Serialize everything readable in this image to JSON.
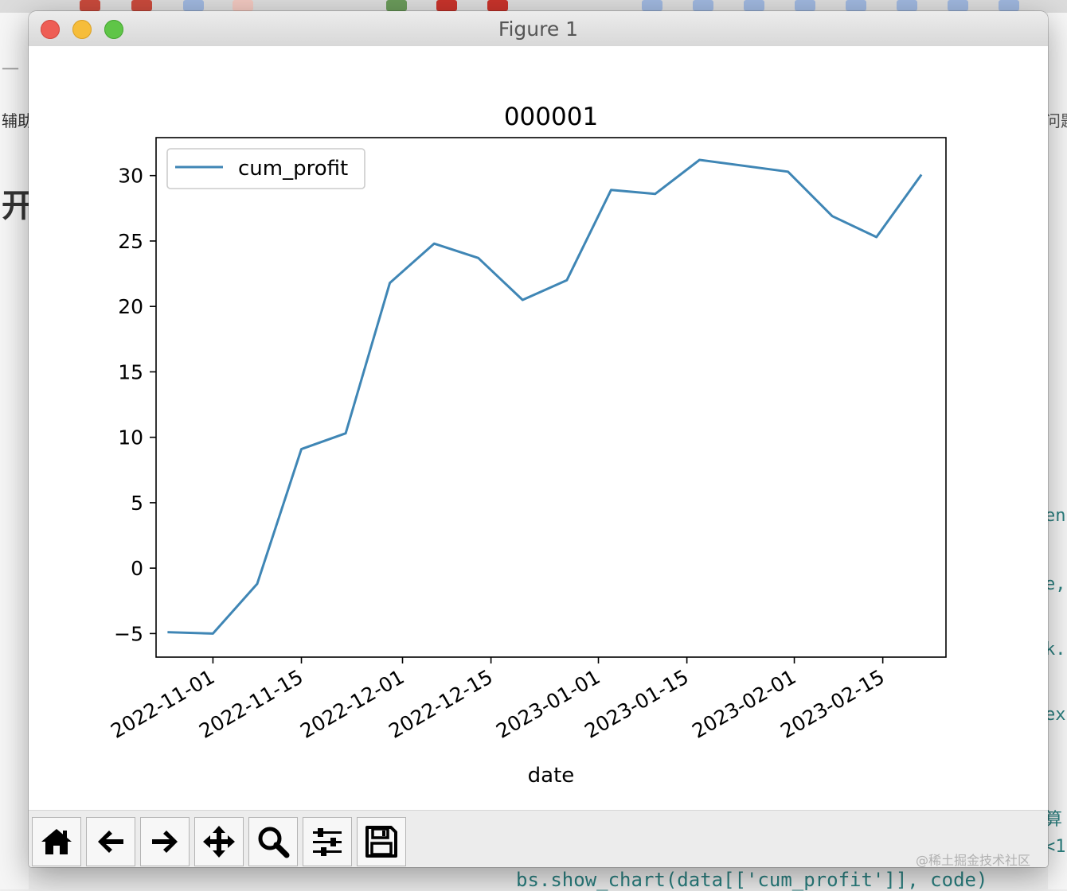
{
  "window": {
    "title": "Figure 1"
  },
  "toolbar": {
    "buttons": [
      {
        "name": "home-button",
        "icon": "home-icon",
        "tip": "Reset original view"
      },
      {
        "name": "back-button",
        "icon": "arrow-left-icon",
        "tip": "Back to previous view"
      },
      {
        "name": "forward-button",
        "icon": "arrow-right-icon",
        "tip": "Forward to next view"
      },
      {
        "name": "pan-button",
        "icon": "move-icon",
        "tip": "Pan axes"
      },
      {
        "name": "zoom-button",
        "icon": "magnifier-icon",
        "tip": "Zoom to rectangle"
      },
      {
        "name": "subplots-button",
        "icon": "sliders-icon",
        "tip": "Configure subplots"
      },
      {
        "name": "save-button",
        "icon": "floppy-disk-icon",
        "tip": "Save the figure"
      }
    ]
  },
  "background": {
    "left_texts": [
      "一",
      "辅助",
      "开"
    ],
    "right_texts": [
      "问题",
      "en",
      "e,",
      "k.",
      "ex",
      "算",
      "<1"
    ],
    "code_line": "bs.show_chart(data[['cum_profit']], code)",
    "watermark": "@稀土掘金技术社区"
  },
  "chart_data": {
    "type": "line",
    "title": "000001",
    "xlabel": "date",
    "ylabel": "",
    "x_type": "date",
    "xlim": [
      "2022-10-23",
      "2023-02-25"
    ],
    "ylim": [
      -6.8,
      32.9
    ],
    "xticks": [
      "2022-11-01",
      "2022-11-15",
      "2022-12-01",
      "2022-12-15",
      "2023-01-01",
      "2023-01-15",
      "2023-02-01",
      "2023-02-15"
    ],
    "yticks": [
      -5,
      0,
      5,
      10,
      15,
      20,
      25,
      30
    ],
    "yticks_labels": [
      "−5",
      "0",
      "5",
      "10",
      "15",
      "20",
      "25",
      "30"
    ],
    "grid": false,
    "legend": {
      "position": "upper-left",
      "entries": [
        "cum_profit"
      ]
    },
    "colors": {
      "line": "#3f86b5",
      "axes": "#000000"
    },
    "series": [
      {
        "name": "cum_profit",
        "x": [
          "2022-10-25",
          "2022-11-01",
          "2022-11-08",
          "2022-11-15",
          "2022-11-22",
          "2022-11-29",
          "2022-12-06",
          "2022-12-13",
          "2022-12-20",
          "2022-12-27",
          "2023-01-03",
          "2023-01-10",
          "2023-01-17",
          "2023-01-31",
          "2023-02-07",
          "2023-02-14",
          "2023-02-21"
        ],
        "y": [
          -4.9,
          -5.0,
          -1.2,
          9.1,
          10.3,
          21.8,
          24.8,
          23.7,
          20.5,
          22.0,
          28.9,
          28.6,
          31.2,
          30.3,
          26.9,
          25.3,
          30.0
        ]
      }
    ]
  }
}
